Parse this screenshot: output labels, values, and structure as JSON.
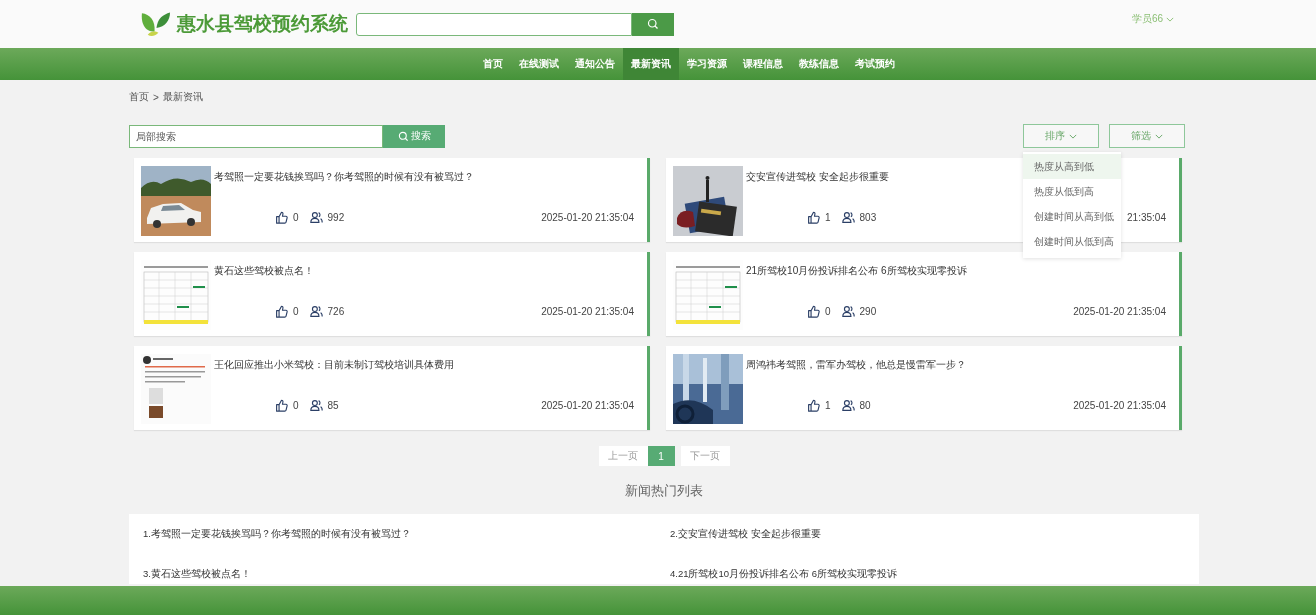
{
  "header": {
    "title": "惠水县驾校预约系统",
    "user": "学员66"
  },
  "nav": [
    {
      "label": "首页",
      "selected": false
    },
    {
      "label": "在线测试",
      "selected": false
    },
    {
      "label": "通知公告",
      "selected": false
    },
    {
      "label": "最新资讯",
      "selected": true
    },
    {
      "label": "学习资源",
      "selected": false
    },
    {
      "label": "课程信息",
      "selected": false
    },
    {
      "label": "教练信息",
      "selected": false
    },
    {
      "label": "考试预约",
      "selected": false
    }
  ],
  "breadcrumb": [
    "首页",
    ">",
    "最新资讯"
  ],
  "local_search": {
    "placeholder": "局部搜索",
    "button": "搜索"
  },
  "sort": {
    "label": "排序",
    "expanded": true,
    "options": [
      {
        "label": "热度从高到低",
        "selected": true
      },
      {
        "label": "热度从低到高",
        "selected": false
      },
      {
        "label": "创建时间从高到低",
        "selected": false
      },
      {
        "label": "创建时间从低到高",
        "selected": false
      }
    ]
  },
  "filter": {
    "label": "筛选"
  },
  "news": [
    {
      "title": "考驾照一定要花钱挨骂吗？你考驾照的时候有没有被骂过？",
      "likes": "0",
      "views": "992",
      "time": "2025-01-20 21:35:04"
    },
    {
      "title": "交安宣传进驾校 安全起步很重要",
      "likes": "1",
      "views": "803",
      "time": "21:35:04"
    },
    {
      "title": "黄石这些驾校被点名！",
      "likes": "0",
      "views": "726",
      "time": "2025-01-20 21:35:04"
    },
    {
      "title": "21所驾校10月份投诉排名公布 6所驾校实现零投诉",
      "likes": "0",
      "views": "290",
      "time": "2025-01-20 21:35:04"
    },
    {
      "title": "王化回应推出小米驾校：目前未制订驾校培训具体费用",
      "likes": "0",
      "views": "85",
      "time": "2025-01-20 21:35:04"
    },
    {
      "title": "周鸿祎考驾照，雷军办驾校，他总是慢雷军一步？",
      "likes": "1",
      "views": "80",
      "time": "2025-01-20 21:35:04"
    }
  ],
  "pagination": [
    {
      "label": "上一页",
      "kind": "prev",
      "disabled": true,
      "selected": false
    },
    {
      "label": "1",
      "kind": "page",
      "disabled": false,
      "selected": true
    },
    {
      "label": "下一页",
      "kind": "next",
      "disabled": true,
      "selected": false
    }
  ],
  "hot_list": {
    "title": "新闻热门列表",
    "items": [
      "1.考驾照一定要花钱挨骂吗？你考驾照的时候有没有被骂过？",
      "2.交安宣传进驾校 安全起步很重要",
      "3.黄石这些驾校被点名！",
      "4.21所驾校10月份投诉排名公布 6所驾校实现零投诉"
    ]
  }
}
